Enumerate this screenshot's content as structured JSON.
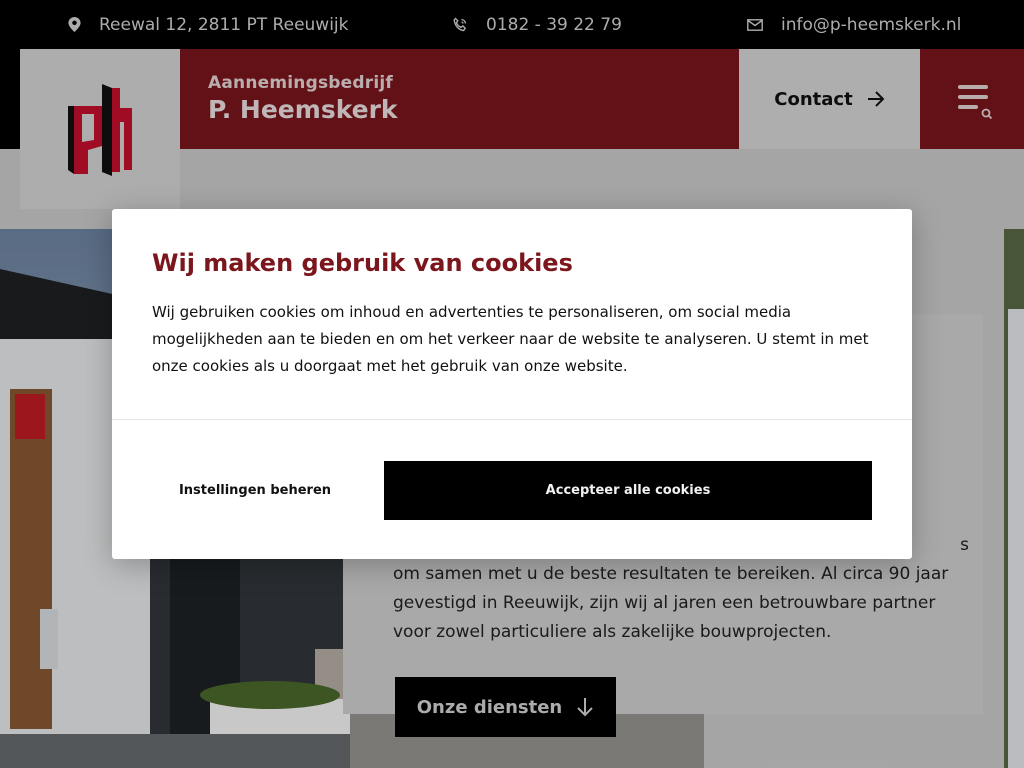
{
  "topbar": {
    "address": "Reewal 12, 2811 PT Reeuwijk",
    "phone": "0182 - 39 22 79",
    "email": "info@p-heemskerk.nl",
    "icons": [
      "location-pin-icon",
      "phone-icon",
      "mail-icon"
    ]
  },
  "brand": {
    "logo": "ph",
    "subtitle": "Aannemingsbedrijf",
    "name": "P. Heemskerk"
  },
  "nav": {
    "contact_label": "Contact",
    "icons": [
      "arrow-right-icon",
      "menu-search-icon"
    ]
  },
  "hero": {
    "text_fragment": "s",
    "text": "om samen met u de beste resultaten te bereiken. Al circa 90 jaar gevestigd in Reeuwijk, zijn wij al jaren een betrouwbare partner voor zowel particuliere als zakelijke bouwprojecten.",
    "services_button": "Onze diensten"
  },
  "cookie_modal": {
    "title": "Wij maken gebruik van cookies",
    "body": "Wij gebruiken cookies om inhoud en advertenties te personaliseren, om social media mogelijkheden aan te bieden en om het verkeer naar de website te analyseren. U stemt in met onze cookies als u doorgaat met het gebruik van onze website.",
    "settings_button": "Instellingen beheren",
    "accept_button": "Accepteer alle cookies"
  },
  "colors": {
    "brand_red": "#7b161d",
    "black": "#000000",
    "light_gray": "#d9d9d9"
  }
}
